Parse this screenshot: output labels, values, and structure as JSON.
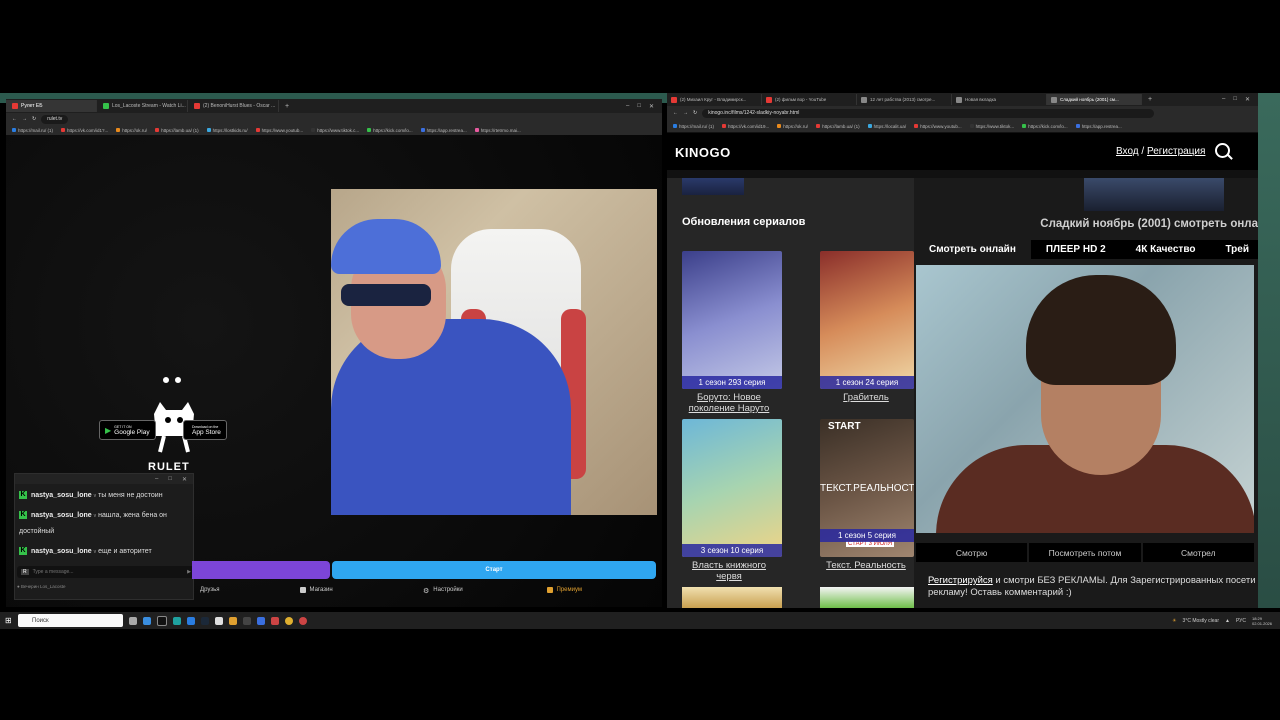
{
  "left_browser": {
    "tabs": [
      {
        "label": "Рулет ЕБ",
        "color": "#e53935",
        "active": true
      },
      {
        "label": "Los_Lacoste Stream - Watch Li...",
        "color": "#35c14a",
        "active": false
      },
      {
        "label": "(2) BenoniHurst Blues - Oscar ...",
        "color": "#e53935",
        "active": false
      }
    ],
    "url": "rulet.tv",
    "bookmarks": [
      "https://mail.ru/ (1)",
      "https://vk.com/id1?...",
      "https://ok.ru/",
      "https://lamb.ua/ (1)",
      "https://lostkids.ru/",
      "https://www.youtub...",
      "https://www.tiktok.c...",
      "https://kick.com/lo...",
      "https://app.restrea...",
      "https://rtetrmo.mai..."
    ]
  },
  "rulet": {
    "logo_text": "RULET",
    "google_play": "Google Play",
    "google_play_small": "GET IT ON",
    "app_store": "App Store",
    "app_store_small": "Download on the",
    "start_button": "Старт",
    "nav": [
      "Друзья",
      "Магазин",
      "Настройки",
      "Премиум"
    ]
  },
  "chat": {
    "messages": [
      {
        "user": "nastya_sosu_lone",
        "text": "ты меня не достоин"
      },
      {
        "user": "nastya_sosu_lone",
        "text": "нашла, жена бена он достойный"
      },
      {
        "user": "nastya_sosu_lone",
        "text": "еще и авторитет"
      }
    ],
    "input_placeholder": "Type a message...",
    "footer": "Вечерин Los_Lacoste"
  },
  "right_browser": {
    "tabs": [
      {
        "label": "(2) Михаил Круг - Владимирск...",
        "color": "#e53935",
        "active": false
      },
      {
        "label": "(2) фильм вор - YouTube",
        "color": "#e53935",
        "active": false
      },
      {
        "label": "12 лет рабства (2013) смотре...",
        "color": "#888888",
        "active": false
      },
      {
        "label": "Новая вкладка",
        "color": "#888888",
        "active": false
      },
      {
        "label": "Сладкий ноябрь (2001) см...",
        "color": "#888888",
        "active": true
      }
    ],
    "url": "kinogo.inc/films/1242-sladkiy-noyabr.html",
    "bookmarks": [
      "https://mail.ru/ (1)",
      "https://vk.com/id19...",
      "https://ok.ru/",
      "https://lamb.ua/ (1)",
      "https://localit.ua/",
      "https://www.youtub...",
      "https://www.tiktok...",
      "https://kick.com/lo...",
      "https://app.restrea..."
    ]
  },
  "kinogo": {
    "logo": "KINOGO",
    "login": "Вход",
    "sep": "/",
    "register": "Регистрация",
    "updates_title": "Обновления сериалов",
    "series": [
      {
        "title": "Боруто: Новое поколение Наруто",
        "badge": "1 сезон 293 серия",
        "color1": "#3b3f8a",
        "color2": "#c4c9e6"
      },
      {
        "title": "Грабитель",
        "badge": "1 сезон 24 серия",
        "color1": "#8a2e2a",
        "color2": "#f0d9a8"
      },
      {
        "title": "Власть книжного червя",
        "badge": "3 сезон 10 серия",
        "color1": "#6db7d8",
        "color2": "#f0d486"
      },
      {
        "title": "Текст. Реальность",
        "badge": "1 сезон 5 серия",
        "color1": "#3a2f26",
        "color2": "#a08670"
      }
    ],
    "start_label": "START",
    "overlay_text": "ТЕКСТ.РЕАЛЬНОСТЬ",
    "start_date": "СТАРТ 3 ИЮЛЯ",
    "movie_title": "Сладкий ноябрь (2001) смотреть онла",
    "player_tabs": [
      "Смотреть онлайн",
      "ПЛЕЕР HD 2",
      "4К Качество",
      "Трей"
    ],
    "player_buttons": [
      "Смотрю",
      "Посмотреть потом",
      "Смотрел"
    ],
    "reg_link": "Регистрируйся",
    "reg_text": " и смотри БЕЗ РЕКЛАМЫ. Для Зарегистрированных посети рекламу! Оставь комментарий :)"
  },
  "taskbar": {
    "search": "Поиск",
    "weather": "3°C  Mostly clear",
    "lang": "РУС",
    "time": "18:29",
    "date": "02.01.2026"
  }
}
